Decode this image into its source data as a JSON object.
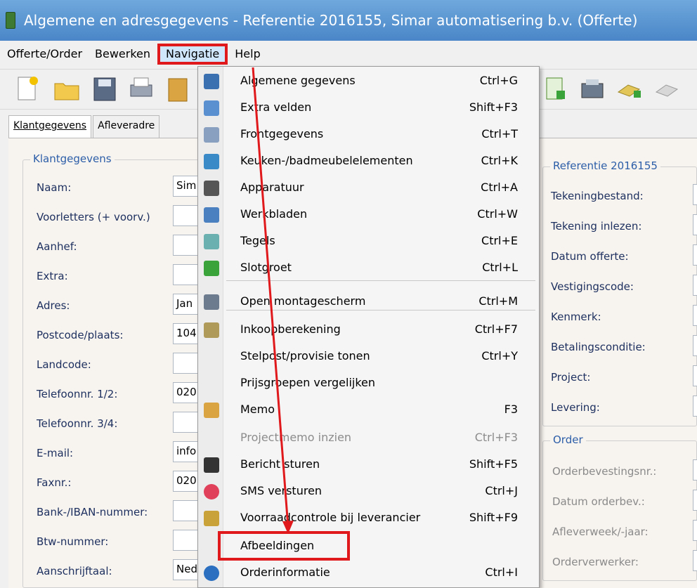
{
  "window": {
    "title": "Algemene en adresgegevens - Referentie 2016155,   Simar automatisering b.v. (Offerte)"
  },
  "menubar": {
    "items": [
      "Offerte/Order",
      "Bewerken",
      "Navigatie",
      "Help"
    ]
  },
  "tabs": [
    "Klantgegevens",
    "Afleveradre"
  ],
  "klant": {
    "group_title": "Klantgegevens",
    "labels": [
      "Naam:",
      "Voorletters (+ voorv.)",
      "Aanhef:",
      "Extra:",
      "Adres:",
      "Postcode/plaats:",
      "Landcode:",
      "Telefoonnr. 1/2:",
      "Telefoonnr. 3/4:",
      "E-mail:",
      "Faxnr.:",
      "Bank-/IBAN-nummer:",
      "Btw-nummer:",
      "Aanschrijftaal:"
    ],
    "values": [
      "Sim",
      "",
      "",
      "",
      "Jan",
      "104",
      "",
      "020",
      "",
      "info",
      "020",
      "",
      "",
      "Ned"
    ]
  },
  "referentie": {
    "group_title": "Referentie 2016155",
    "labels": [
      "Tekeningbestand:",
      "Tekening inlezen:",
      "Datum offerte:",
      "Vestigingscode:",
      "Kenmerk:",
      "Betalingsconditie:",
      "Project:",
      "Levering:"
    ]
  },
  "order": {
    "group_title": "Order",
    "labels": [
      "Orderbevestingsnr.:",
      "Datum orderbev.:",
      "Afleverweek/-jaar:",
      "Orderverwerker:"
    ]
  },
  "navigatie_menu": {
    "items": [
      {
        "label": "Algemene gegevens",
        "shortcut": "Ctrl+G",
        "icon": "general-icon"
      },
      {
        "label": "Extra velden",
        "shortcut": "Shift+F3",
        "icon": "extra-fields-icon"
      },
      {
        "label": "Frontgegevens",
        "shortcut": "Ctrl+T",
        "icon": "front-icon"
      },
      {
        "label": "Keuken-/badmeubelelementen",
        "shortcut": "Ctrl+K",
        "icon": "cabinet-icon"
      },
      {
        "label": "Apparatuur",
        "shortcut": "Ctrl+A",
        "icon": "appliance-icon"
      },
      {
        "label": "Werkbladen",
        "shortcut": "Ctrl+W",
        "icon": "worktop-icon"
      },
      {
        "label": "Tegels",
        "shortcut": "Ctrl+E",
        "icon": "tiles-icon"
      },
      {
        "label": "Slotgroet",
        "shortcut": "Ctrl+L",
        "icon": "closing-icon"
      },
      {
        "label": "Open montagescherm",
        "shortcut": "Ctrl+M",
        "icon": "assembly-icon"
      },
      {
        "label": "Inkoopberekening",
        "shortcut": "Ctrl+F7",
        "icon": "purchase-icon"
      },
      {
        "label": "Stelpost/provisie tonen",
        "shortcut": "Ctrl+Y",
        "icon": ""
      },
      {
        "label": "Prijsgroepen vergelijken",
        "shortcut": "",
        "icon": ""
      },
      {
        "label": "Memo",
        "shortcut": "F3",
        "icon": "memo-icon"
      },
      {
        "label": "Projectmemo inzien",
        "shortcut": "Ctrl+F3",
        "icon": "",
        "disabled": true
      },
      {
        "label": "Bericht sturen",
        "shortcut": "Shift+F5",
        "icon": "message-icon"
      },
      {
        "label": "SMS versturen",
        "shortcut": "Ctrl+J",
        "icon": "sms-icon"
      },
      {
        "label": "Voorraadcontrole bij leverancier",
        "shortcut": "Shift+F9",
        "icon": "stock-icon"
      },
      {
        "label": "Afbeeldingen",
        "shortcut": "",
        "icon": ""
      },
      {
        "label": "Orderinformatie",
        "shortcut": "Ctrl+I",
        "icon": "info-icon"
      }
    ]
  },
  "colors": {
    "highlight": "#e0191c",
    "titlebar": "#4a86c8",
    "group_title": "#2c5ea8"
  }
}
